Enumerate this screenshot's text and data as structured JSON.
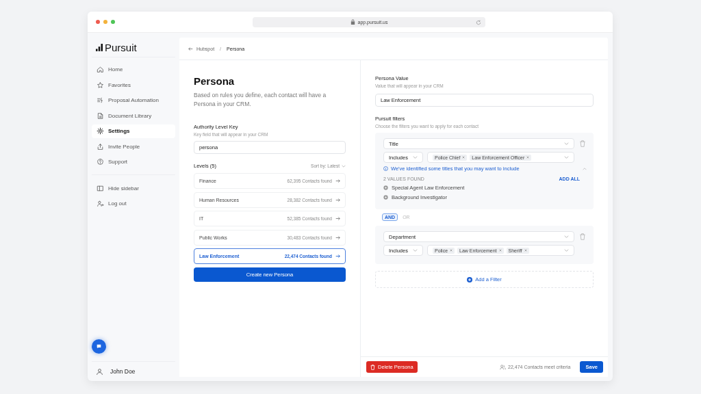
{
  "browser": {
    "url": "app.pursuit.us"
  },
  "sidebar": {
    "logo": "Pursuit",
    "items": [
      {
        "label": "Home",
        "selected": false
      },
      {
        "label": "Favorites",
        "selected": false
      },
      {
        "label": "Proposal Automation",
        "selected": false
      },
      {
        "label": "Document Library",
        "selected": false
      },
      {
        "label": "Settings",
        "selected": true
      },
      {
        "label": "Invite People",
        "selected": false
      },
      {
        "label": "Support",
        "selected": false
      }
    ],
    "bottom_items": [
      {
        "label": "Hide sidebar"
      },
      {
        "label": "Log out"
      }
    ],
    "user": "John Doe"
  },
  "breadcrumb": {
    "separator": "/",
    "items": [
      "Hubspot",
      "Persona"
    ]
  },
  "persona": {
    "title": "Persona",
    "description": "Based on rules you define, each contact will have a Persona in your CRM.",
    "key_label": "Authority Level Key",
    "key_hint": "Key field that will appear in your CRM",
    "key_value": "persona",
    "levels_title": "Levels (5)",
    "sort_label": "Sort by: Latest",
    "levels": [
      {
        "name": "Finance",
        "count": "62,395 Contacts found",
        "selected": false
      },
      {
        "name": "Human Resources",
        "count": "28,382 Contacts found",
        "selected": false
      },
      {
        "name": "IT",
        "count": "52,385 Contacts found",
        "selected": false
      },
      {
        "name": "Public Works",
        "count": "30,483 Contacts found",
        "selected": false
      },
      {
        "name": "Law Enforcement",
        "count": "22,474 Contacts found",
        "selected": true
      }
    ],
    "create_button": "Create new Persona"
  },
  "editor": {
    "value_label": "Persona Value",
    "value_hint": "Value that will appear in your CRM",
    "value": "Law Enforcement",
    "filters_title": "Pursuit filters",
    "filters_hint": "Choose the filters you want to apply for each contact",
    "filters": [
      {
        "field": "Title",
        "operator": "Includes",
        "tags": [
          "Police Chief",
          "Law Enforcement Officer"
        ],
        "suggestion": {
          "message": "We've identified some titles that you may want to include",
          "count_label": "2 VALUES FOUND",
          "add_all": "ADD ALL",
          "values": [
            "Special Agent Law Enforcement",
            "Background Investigator"
          ]
        }
      },
      {
        "field": "Department",
        "operator": "Includes",
        "tags": [
          "Police",
          "Law Enforcement",
          "Sheriff"
        ]
      }
    ],
    "connectors": [
      {
        "label": "AND",
        "selected": true
      },
      {
        "label": "OR",
        "selected": false
      }
    ],
    "add_filter": "Add a Filter",
    "delete_button": "Delete Persona",
    "contacts": "22,474 Contacts meet criteria",
    "save_button": "Save"
  }
}
